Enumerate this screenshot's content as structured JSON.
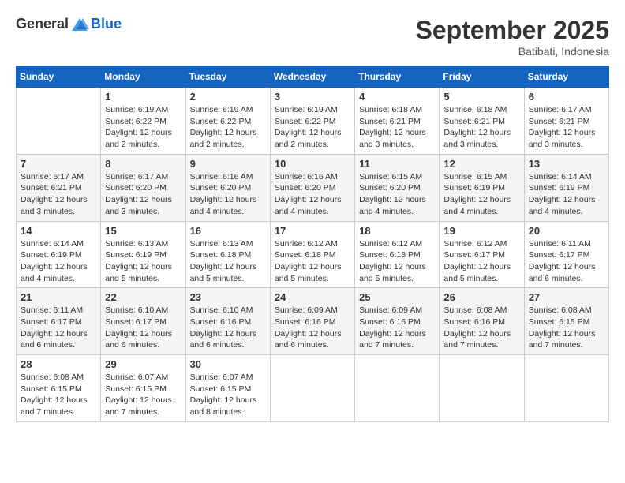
{
  "header": {
    "logo": {
      "general": "General",
      "blue": "Blue"
    },
    "title": "September 2025",
    "location": "Batibati, Indonesia"
  },
  "weekdays": [
    "Sunday",
    "Monday",
    "Tuesday",
    "Wednesday",
    "Thursday",
    "Friday",
    "Saturday"
  ],
  "weeks": [
    [
      {
        "day": "",
        "text": ""
      },
      {
        "day": "1",
        "text": "Sunrise: 6:19 AM\nSunset: 6:22 PM\nDaylight: 12 hours\nand 2 minutes."
      },
      {
        "day": "2",
        "text": "Sunrise: 6:19 AM\nSunset: 6:22 PM\nDaylight: 12 hours\nand 2 minutes."
      },
      {
        "day": "3",
        "text": "Sunrise: 6:19 AM\nSunset: 6:22 PM\nDaylight: 12 hours\nand 2 minutes."
      },
      {
        "day": "4",
        "text": "Sunrise: 6:18 AM\nSunset: 6:21 PM\nDaylight: 12 hours\nand 3 minutes."
      },
      {
        "day": "5",
        "text": "Sunrise: 6:18 AM\nSunset: 6:21 PM\nDaylight: 12 hours\nand 3 minutes."
      },
      {
        "day": "6",
        "text": "Sunrise: 6:17 AM\nSunset: 6:21 PM\nDaylight: 12 hours\nand 3 minutes."
      }
    ],
    [
      {
        "day": "7",
        "text": "Sunrise: 6:17 AM\nSunset: 6:21 PM\nDaylight: 12 hours\nand 3 minutes."
      },
      {
        "day": "8",
        "text": "Sunrise: 6:17 AM\nSunset: 6:20 PM\nDaylight: 12 hours\nand 3 minutes."
      },
      {
        "day": "9",
        "text": "Sunrise: 6:16 AM\nSunset: 6:20 PM\nDaylight: 12 hours\nand 4 minutes."
      },
      {
        "day": "10",
        "text": "Sunrise: 6:16 AM\nSunset: 6:20 PM\nDaylight: 12 hours\nand 4 minutes."
      },
      {
        "day": "11",
        "text": "Sunrise: 6:15 AM\nSunset: 6:20 PM\nDaylight: 12 hours\nand 4 minutes."
      },
      {
        "day": "12",
        "text": "Sunrise: 6:15 AM\nSunset: 6:19 PM\nDaylight: 12 hours\nand 4 minutes."
      },
      {
        "day": "13",
        "text": "Sunrise: 6:14 AM\nSunset: 6:19 PM\nDaylight: 12 hours\nand 4 minutes."
      }
    ],
    [
      {
        "day": "14",
        "text": "Sunrise: 6:14 AM\nSunset: 6:19 PM\nDaylight: 12 hours\nand 4 minutes."
      },
      {
        "day": "15",
        "text": "Sunrise: 6:13 AM\nSunset: 6:19 PM\nDaylight: 12 hours\nand 5 minutes."
      },
      {
        "day": "16",
        "text": "Sunrise: 6:13 AM\nSunset: 6:18 PM\nDaylight: 12 hours\nand 5 minutes."
      },
      {
        "day": "17",
        "text": "Sunrise: 6:12 AM\nSunset: 6:18 PM\nDaylight: 12 hours\nand 5 minutes."
      },
      {
        "day": "18",
        "text": "Sunrise: 6:12 AM\nSunset: 6:18 PM\nDaylight: 12 hours\nand 5 minutes."
      },
      {
        "day": "19",
        "text": "Sunrise: 6:12 AM\nSunset: 6:17 PM\nDaylight: 12 hours\nand 5 minutes."
      },
      {
        "day": "20",
        "text": "Sunrise: 6:11 AM\nSunset: 6:17 PM\nDaylight: 12 hours\nand 6 minutes."
      }
    ],
    [
      {
        "day": "21",
        "text": "Sunrise: 6:11 AM\nSunset: 6:17 PM\nDaylight: 12 hours\nand 6 minutes."
      },
      {
        "day": "22",
        "text": "Sunrise: 6:10 AM\nSunset: 6:17 PM\nDaylight: 12 hours\nand 6 minutes."
      },
      {
        "day": "23",
        "text": "Sunrise: 6:10 AM\nSunset: 6:16 PM\nDaylight: 12 hours\nand 6 minutes."
      },
      {
        "day": "24",
        "text": "Sunrise: 6:09 AM\nSunset: 6:16 PM\nDaylight: 12 hours\nand 6 minutes."
      },
      {
        "day": "25",
        "text": "Sunrise: 6:09 AM\nSunset: 6:16 PM\nDaylight: 12 hours\nand 7 minutes."
      },
      {
        "day": "26",
        "text": "Sunrise: 6:08 AM\nSunset: 6:16 PM\nDaylight: 12 hours\nand 7 minutes."
      },
      {
        "day": "27",
        "text": "Sunrise: 6:08 AM\nSunset: 6:15 PM\nDaylight: 12 hours\nand 7 minutes."
      }
    ],
    [
      {
        "day": "28",
        "text": "Sunrise: 6:08 AM\nSunset: 6:15 PM\nDaylight: 12 hours\nand 7 minutes."
      },
      {
        "day": "29",
        "text": "Sunrise: 6:07 AM\nSunset: 6:15 PM\nDaylight: 12 hours\nand 7 minutes."
      },
      {
        "day": "30",
        "text": "Sunrise: 6:07 AM\nSunset: 6:15 PM\nDaylight: 12 hours\nand 8 minutes."
      },
      {
        "day": "",
        "text": ""
      },
      {
        "day": "",
        "text": ""
      },
      {
        "day": "",
        "text": ""
      },
      {
        "day": "",
        "text": ""
      }
    ]
  ]
}
